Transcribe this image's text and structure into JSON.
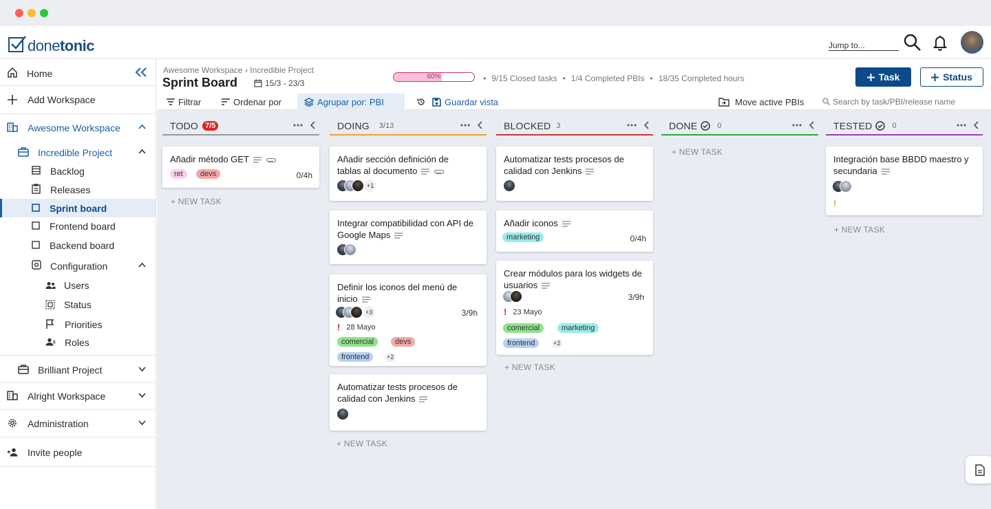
{
  "app": {
    "logo_done": "done",
    "logo_tonic": "tonic",
    "jump_placeholder": "Jump to..."
  },
  "colors": {
    "primary": "#0d4a8a",
    "active_bg": "#e3ecf7",
    "board_bg": "#e9edf3"
  },
  "sidebar": {
    "home": "Home",
    "add_workspace": "Add Workspace",
    "workspace": "Awesome Workspace",
    "project": "Incredible Project",
    "items": [
      "Backlog",
      "Releases",
      "Sprint board",
      "Frontend board",
      "Backend board",
      "Configuration"
    ],
    "config_items": [
      "Users",
      "Status",
      "Priorities",
      "Roles"
    ],
    "brilliant": "Brilliant Project",
    "alright": "Alright Workspace",
    "administration": "Administration",
    "invite": "Invite people"
  },
  "header": {
    "breadcrumb": "Awesome Workspace › Incredible Project",
    "title": "Sprint Board",
    "dates": "15/3 - 23/3",
    "progress_label": "60%",
    "progress_value": 60,
    "stats": [
      "•",
      "9/15 Closed tasks",
      "•",
      "1/4 Completed PBIs",
      "•",
      "18/35 Completed hours"
    ],
    "task_btn": "Task",
    "status_btn": "Status"
  },
  "toolbar": {
    "filter": "Filtrar",
    "sort": "Ordenar por",
    "group": "Agrupar por: PBI",
    "save": "Guardar vista",
    "move": "Move active PBIs",
    "search_placeholder": "Search by task/PBI/release name"
  },
  "columns": [
    {
      "name": "TODO",
      "count": "7/5",
      "color": "#e02424"
    },
    {
      "name": "DOING",
      "count": "3/13",
      "color": "#f0a030"
    },
    {
      "name": "BLOCKED",
      "count": "3",
      "color": "#d93030"
    },
    {
      "name": "DONE",
      "count": "0",
      "color": "#2ea83a"
    },
    {
      "name": "TESTED",
      "count": "0",
      "color": "#9b3fb0"
    }
  ],
  "new_task": "+ NEW TASK",
  "cards": {
    "todo1": {
      "title": "Añadir método GET",
      "tags": [
        "ret",
        "devs"
      ],
      "hours": "0/4h"
    },
    "doing1": {
      "title": "Añadir sección definición de tablas al documento",
      "more": "+1"
    },
    "doing2": {
      "title": "Integrar compatibilidad con API de Google Maps"
    },
    "doing3": {
      "title": "Definir los iconos del menú de inicio",
      "more": "+3",
      "hours": "3/9h",
      "priority": "!",
      "due": "28 Mayo",
      "tags": [
        "comercial",
        "devs",
        "frontend"
      ],
      "extra": "+2"
    },
    "doing4": {
      "title": "Automatizar tests procesos de calidad con Jenkins"
    },
    "blocked1": {
      "title": "Automatizar tests procesos de calidad con Jenkins"
    },
    "blocked2": {
      "title": "Añadir iconos",
      "tags": [
        "marketing"
      ],
      "hours": "0/4h"
    },
    "blocked3": {
      "title": "Crear módulos para los widgets de usuarios",
      "hours": "3/9h",
      "priority": "!",
      "due": "23 Mayo",
      "tags": [
        "comercial",
        "marketing",
        "frontend"
      ],
      "extra": "+2"
    },
    "tested1": {
      "title": "Integración base BBDD maestro y secundaria",
      "priority": "!"
    }
  }
}
